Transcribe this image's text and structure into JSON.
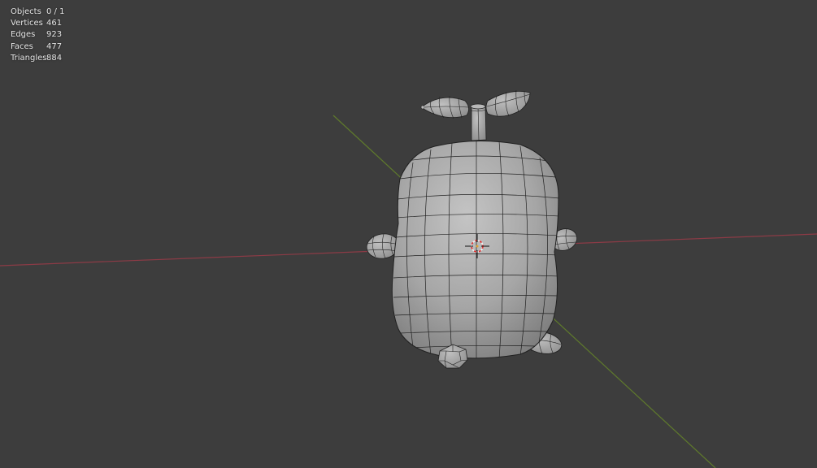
{
  "stats": [
    {
      "label": "Objects",
      "value": "0 / 1"
    },
    {
      "label": "Vertices",
      "value": "461"
    },
    {
      "label": "Edges",
      "value": "923"
    },
    {
      "label": "Faces",
      "value": "477"
    },
    {
      "label": "Triangles",
      "value": "884"
    }
  ],
  "colors": {
    "background": "#3d3d3d",
    "x_axis": "#8c3b46",
    "y_axis": "#5f7a2c",
    "mesh_fill": "#a9a9a9",
    "wire": "#202020",
    "cursor_red": "#e03030",
    "cursor_white": "#f2f2f2"
  },
  "icons": [
    "3d-cursor-icon"
  ]
}
